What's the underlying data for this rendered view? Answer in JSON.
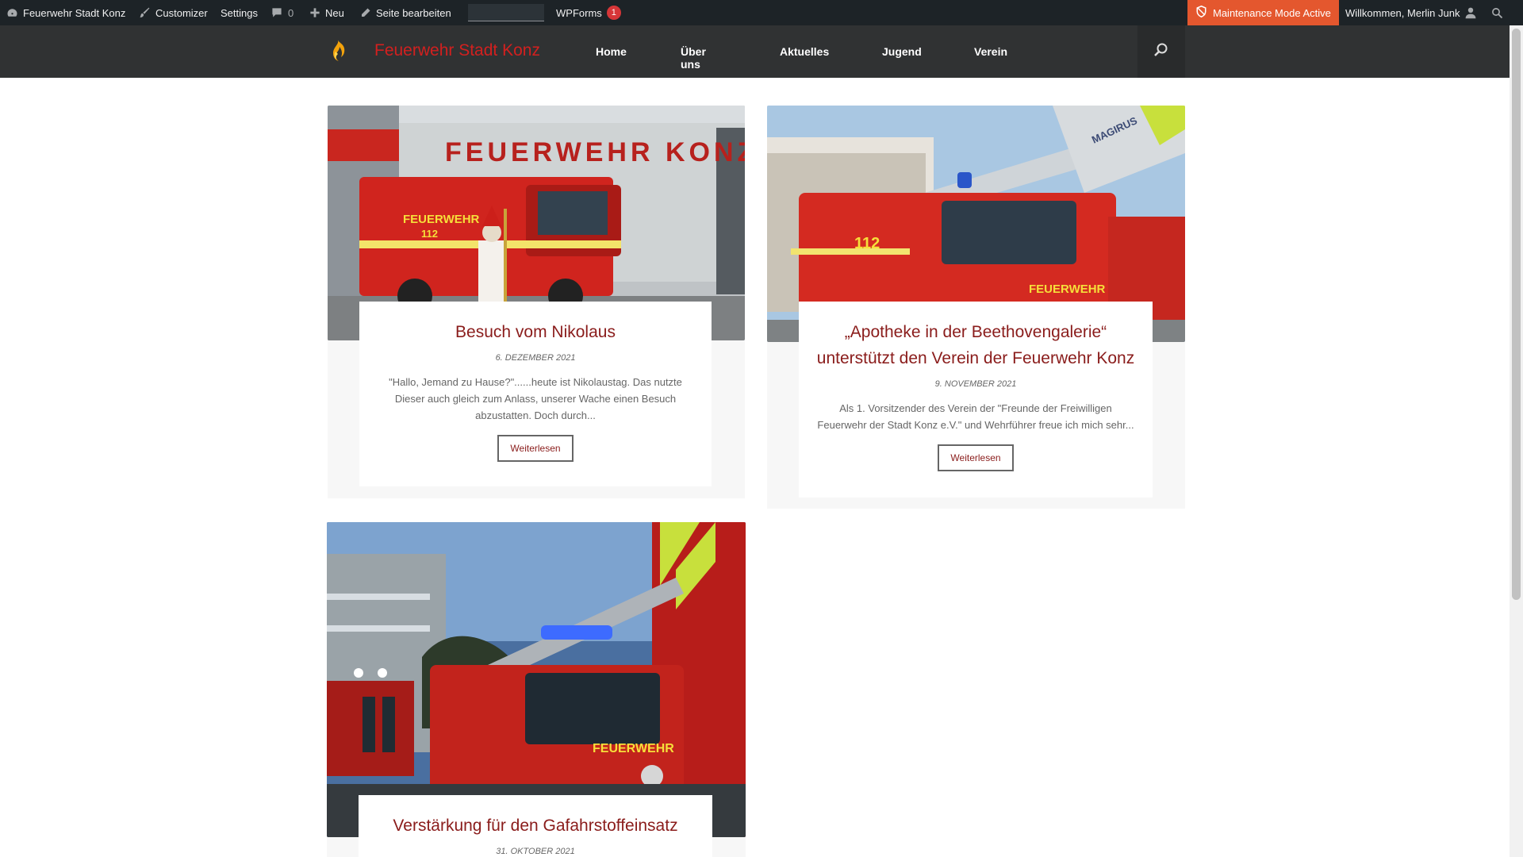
{
  "admin_bar": {
    "site_name": "Feuerwehr Stadt Konz",
    "customizer": "Customizer",
    "settings": "Settings",
    "comments_count": "0",
    "new": "Neu",
    "edit_page": "Seite bearbeiten",
    "wpforms": "WPForms",
    "wpforms_badge": "1",
    "maintenance": "Maintenance Mode Active",
    "welcome": "Willkommen, Merlin Junk"
  },
  "header": {
    "site_title": "Feuerwehr Stadt Konz",
    "nav": [
      "Home",
      "Über uns",
      "Aktuelles",
      "Jugend",
      "Verein"
    ]
  },
  "posts": [
    {
      "title": "Besuch vom Nikolaus",
      "date": "6. Dezember 2021",
      "excerpt": "\"Hallo, Jemand zu Hause?\"......heute ist Nikolaustag. Das nutzte Dieser auch gleich zum Anlass, unserer Wache einen Besuch abzustatten. Doch durch...",
      "button": "Weiterlesen",
      "image_text": "FEUERWEHR KONZ",
      "truck_text": "FEUERWEHR",
      "truck_number": "112"
    },
    {
      "title": "„Apotheke in der Beethovengalerie“ unterstützt den Verein der Feuerwehr Konz",
      "date": "9. November 2021",
      "excerpt": "Als 1. Vorsitzender des Verein der \"Freunde der Freiwilligen Feuerwehr der Stadt Konz e.V.\" und Wehrführer freue ich mich sehr...",
      "button": "Weiterlesen",
      "image_text": "MAGIRUS",
      "truck_text": "FEUERWEHR",
      "truck_number": "112"
    },
    {
      "title": "Verstärkung für den Gafahrstoffeinsatz",
      "date": "31. Oktober 2021",
      "truck_text": "FEUERWEHR"
    }
  ],
  "colors": {
    "accent": "#d2201f",
    "title_red": "#8a1c1b",
    "admin_bar": "#1d2327",
    "header": "#303233",
    "maintenance": "#e4572e"
  }
}
